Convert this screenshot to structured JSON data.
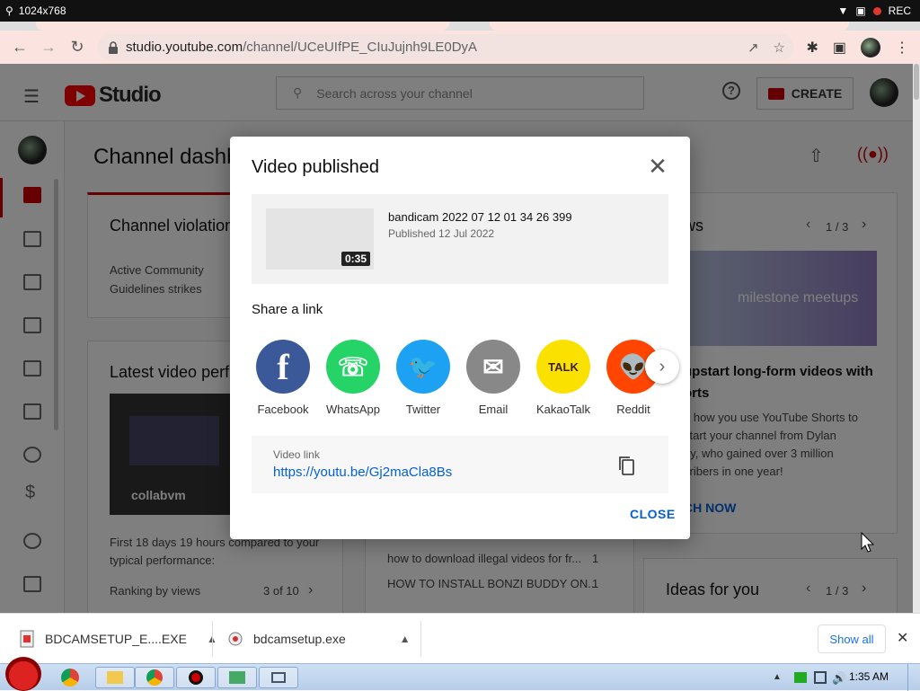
{
  "recorder": {
    "resolution": "1024x768",
    "rec_label": "REC"
  },
  "browser": {
    "url_domain": "studio.youtube.com",
    "url_path": "/channel/UCeUIfPE_CIuJujnh9LE0DyA"
  },
  "studio": {
    "logo_text": "Studio",
    "search_placeholder": "Search across your channel",
    "create_label": "CREATE",
    "page_title": "Channel dashb",
    "violations_title": "Channel violation",
    "violations_text_1": "Active Community",
    "violations_text_2": "Guidelines strikes",
    "latest_title": "Latest video perf",
    "thumb_caption": "collabvm",
    "perf_text_1": "First 18 days 19 hours compared to your",
    "perf_text_2": "typical performance:",
    "ranking_label": "Ranking by views",
    "ranking_value": "3 of 10",
    "news_title": "ws",
    "news_pager": "1 / 3",
    "news_banner_text": "milestone meetups",
    "news_headline_1": "upstart long-form videos with",
    "news_headline_2": "orts",
    "news_body_1": "n how you use YouTube Shorts to",
    "news_body_2": "start your channel from Dylan",
    "news_body_3": "ay, who gained over 3 million",
    "news_body_4": "cribers in one year!",
    "news_cta": "CH NOW",
    "top_videos": [
      {
        "title": "how to download illegal videos for fr...",
        "count": "1"
      },
      {
        "title": "HOW TO INSTALL BONZI BUDDY ON...",
        "count": "1"
      }
    ],
    "ideas_title": "Ideas for you",
    "ideas_pager": "1 / 3"
  },
  "modal": {
    "title": "Video published",
    "video_title": "bandicam 2022 07 12 01 34 26 399",
    "video_published": "Published 12 Jul 2022",
    "duration": "0:35",
    "share_heading": "Share a link",
    "share_targets": [
      {
        "label": "Facebook",
        "color": "#3b5998",
        "glyph": "f"
      },
      {
        "label": "WhatsApp",
        "color": "#25d366",
        "glyph": "☏"
      },
      {
        "label": "Twitter",
        "color": "#1da1f2",
        "glyph": "🐦"
      },
      {
        "label": "Email",
        "color": "#888888",
        "glyph": "✉"
      },
      {
        "label": "KakaoTalk",
        "color": "#fae100",
        "glyph": "TALK"
      },
      {
        "label": "Reddit",
        "color": "#ff4500",
        "glyph": "👽"
      }
    ],
    "link_label": "Video link",
    "link_value": "https://youtu.be/Gj2maCla8Bs",
    "close_label": "CLOSE"
  },
  "downloads": [
    {
      "name": "BDCAMSETUP_E....EXE"
    },
    {
      "name": "bdcamsetup.exe"
    }
  ],
  "downloads_show_all": "Show all",
  "taskbar": {
    "clock": "1:35 AM"
  }
}
